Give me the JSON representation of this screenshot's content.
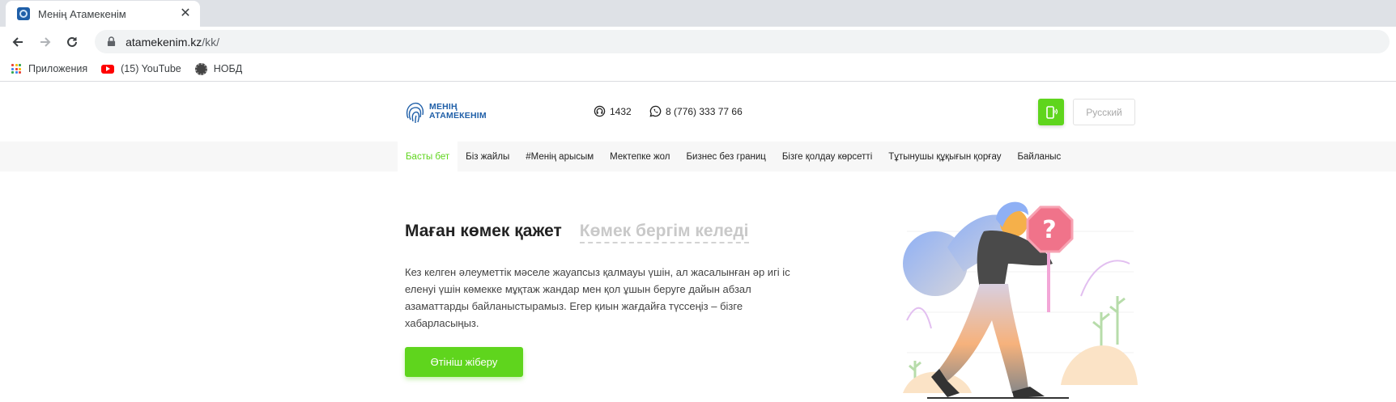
{
  "browser": {
    "tab_title": "Менің Атамекенім",
    "close_symbol": "✕",
    "url_domain": "atamekenim.kz",
    "url_path": "/kk/",
    "bookmarks": [
      {
        "label": "Приложения",
        "icon": "apps-grid-icon"
      },
      {
        "label": "(15) YouTube",
        "icon": "youtube-icon"
      },
      {
        "label": "НОБД",
        "icon": "nobd-icon"
      }
    ]
  },
  "header": {
    "logo_line1": "МЕНІҢ",
    "logo_line2": "АТАМЕКЕНІМ",
    "hotline": "1432",
    "whatsapp": "8 (776) 333 77 66",
    "lang_button": "Русский",
    "brand_color": "#5fd51d",
    "logo_color": "#1f5fa8"
  },
  "nav": {
    "items": [
      "Басты бет",
      "Біз жайлы",
      "#Менің арысым",
      "Мектепке жол",
      "Бизнес без границ",
      "Бізге қолдау көрсетті",
      "Тұтынушы құқығын қорғау",
      "Байланыс"
    ],
    "active_index": 0
  },
  "hero": {
    "tab_need": "Маған көмек қажет",
    "tab_give": "Көмек бергім келеді",
    "text": "Кез келген әлеуметтік мәселе жауапсыз қалмауы үшін, ал жасалынған әр игі іс еленуі үшін көмекке мұқтаж жандар мен қол ұшын беруге дайын абзал азаматтарды байланыстырамыз. Егер қиын жағдайға түссеңіз – бізге хабарласыңыз.",
    "cta": "Өтініш жіберу"
  }
}
